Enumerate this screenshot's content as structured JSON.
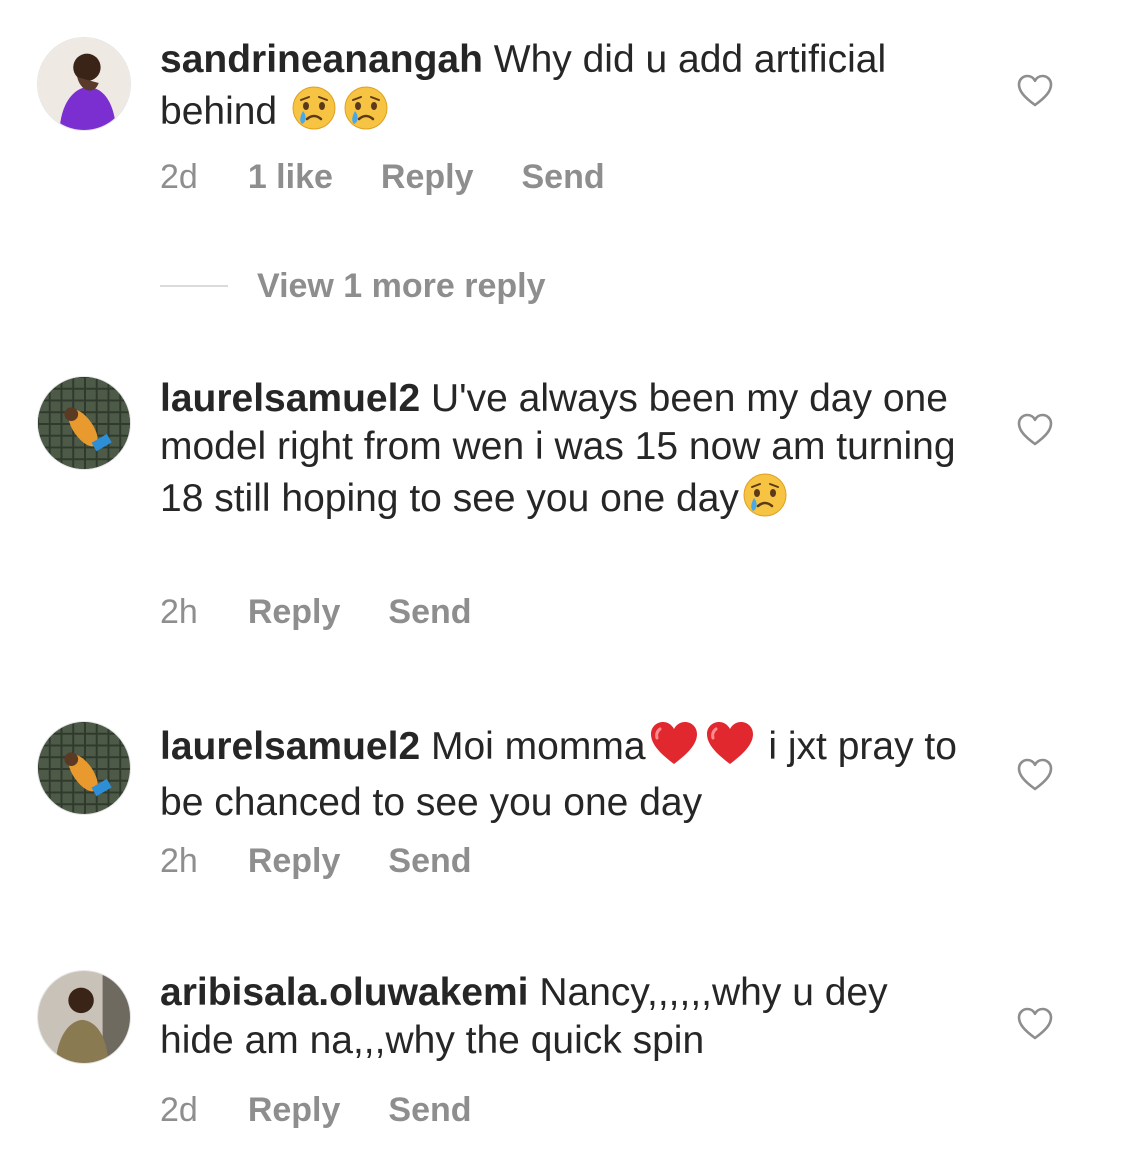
{
  "comments": [
    {
      "username": "sandrineanangah",
      "text_parts": [
        "Why did u add artificial behind "
      ],
      "time": "2d",
      "likes": "1 like",
      "reply": "Reply",
      "send": "Send",
      "avatar_color": "#7b2fd0"
    },
    {
      "username": "laurelsamuel2",
      "text_parts": [
        "U've always been my day one model right from wen i was 15 now am turning 18 still hoping to see you one day"
      ],
      "time": "2h",
      "reply": "Reply",
      "send": "Send",
      "avatar_color": "#2f3a2c"
    },
    {
      "username": "laurelsamuel2",
      "text_parts": [
        "Moi momma",
        " i jxt pray to be chanced to see you one day"
      ],
      "time": "2h",
      "reply": "Reply",
      "send": "Send",
      "avatar_color": "#2f3a2c"
    },
    {
      "username": "aribisala.oluwakemi",
      "text_parts": [
        "Nancy,,,,,,why u dey hide am na,,,why the quick spin"
      ],
      "time": "2d",
      "reply": "Reply",
      "send": "Send",
      "avatar_color": "#8a7a52"
    }
  ],
  "view_more": "View 1 more reply",
  "icons": {
    "heart": "heart-outline-icon",
    "crying": "crying-face-emoji",
    "red_heart": "red-heart-emoji"
  },
  "colors": {
    "text": "#262626",
    "secondary": "#8e8e8e",
    "divider": "#dbdbdb",
    "emoji_heart": "#e0282e"
  }
}
